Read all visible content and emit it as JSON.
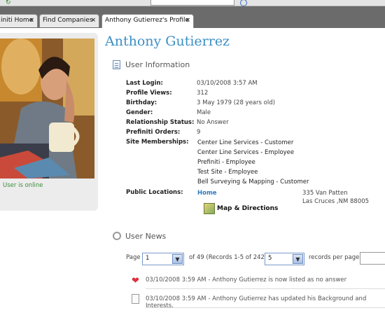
{
  "tabs": [
    {
      "label": "initi Home",
      "close": "×"
    },
    {
      "label": "Find Companies",
      "close": "×"
    },
    {
      "label": "Anthony Gutierrez's Profile",
      "close": "×"
    }
  ],
  "profile": {
    "name": "Anthony Gutierrez",
    "status": "User is online"
  },
  "user_info": {
    "title": "User Information",
    "fields": [
      {
        "label": "Last Login:",
        "value": "03/10/2008 3:57 AM"
      },
      {
        "label": "Profile Views:",
        "value": "312"
      },
      {
        "label": "Birthday:",
        "value": "3 May 1979 (28 years old)"
      },
      {
        "label": "Gender:",
        "value": "Male"
      },
      {
        "label": "Relationship Status:",
        "value": "No Answer"
      },
      {
        "label": "Prefiniti Orders:",
        "value": "9"
      }
    ],
    "memberships_label": "Site Memberships:",
    "memberships": [
      "Center Line Services - Customer",
      "Center Line Services - Employee",
      "Prefiniti - Employee",
      "Test Site - Employee",
      "Bell Surveying & Mapping - Customer"
    ],
    "locations_label": "Public Locations:",
    "location_name": "Home",
    "address_line1": "335 Van Patten",
    "address_line2": "Las Cruces ,NM 88005",
    "map_link": "Map & Directions"
  },
  "user_news": {
    "title": "User News",
    "page_label": "Page",
    "page_value": "1",
    "page_info": "of 49 (Records 1-5 of 242)",
    "per_page_value": "5",
    "per_page_label": "records per page.",
    "items": [
      "03/10/2008 3:59 AM - Anthony Gutierrez is now listed as no answer",
      "03/10/2008 3:59 AM - Anthony Gutierrez has updated his Background and Interests."
    ]
  }
}
